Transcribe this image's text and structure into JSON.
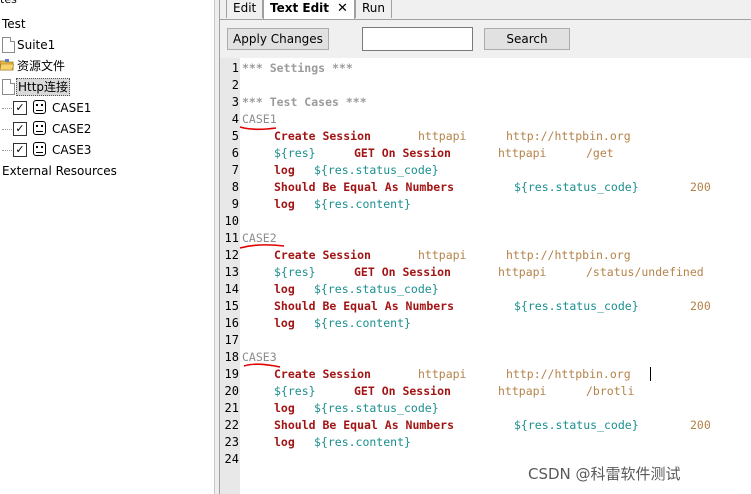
{
  "tree": {
    "header": "tes",
    "root": "Test",
    "suite": "Suite1",
    "resource_folder": "资源文件",
    "http_file": "Http连接",
    "cases": [
      "CASE1",
      "CASE2",
      "CASE3"
    ],
    "external": "External Resources"
  },
  "tabs": [
    "Edit",
    "Text Edit",
    "Run"
  ],
  "active_tab": "Text Edit",
  "toolbar": {
    "apply_label": "Apply Changes",
    "search_value": "",
    "search_label": "Search"
  },
  "editor": {
    "line_numbers": [
      "1",
      "2",
      "3",
      "4",
      "5",
      "6",
      "7",
      "8",
      "9",
      "10",
      "11",
      "12",
      "13",
      "14",
      "15",
      "16",
      "17",
      "18",
      "19",
      "20",
      "21",
      "22",
      "23",
      "24"
    ],
    "settings_header": "*** Settings ***",
    "testcases_header": "*** Test Cases ***",
    "blocks": [
      {
        "name": "CASE1",
        "create_kw": "Create Session",
        "create_alias": "httpapi",
        "create_url": "http://httpbin.org",
        "get_var": "${res}",
        "get_kw": "GET On Session",
        "get_alias": "httpapi",
        "get_path": "/get",
        "log1_kw": "log",
        "log1_arg": "${res.status_code}",
        "assert_kw": "Should Be Equal As Numbers",
        "assert_arg": "${res.status_code}",
        "assert_expected": "200",
        "log2_kw": "log",
        "log2_arg": "${res.content}"
      },
      {
        "name": "CASE2",
        "create_kw": "Create Session",
        "create_alias": "httpapi",
        "create_url": "http://httpbin.org",
        "get_var": "${res}",
        "get_kw": "GET On Session",
        "get_alias": "httpapi",
        "get_path": "/status/undefined",
        "log1_kw": "log",
        "log1_arg": "${res.status_code}",
        "assert_kw": "Should Be Equal As Numbers",
        "assert_arg": "${res.status_code}",
        "assert_expected": "200",
        "log2_kw": "log",
        "log2_arg": "${res.content}"
      },
      {
        "name": "CASE3",
        "create_kw": "Create Session",
        "create_alias": "httpapi",
        "create_url": "http://httpbin.org",
        "get_var": "${res}",
        "get_kw": "GET On Session",
        "get_alias": "httpapi",
        "get_path": "/brotli",
        "log1_kw": "log",
        "log1_arg": "${res.status_code}",
        "assert_kw": "Should Be Equal As Numbers",
        "assert_arg": "${res.status_code}",
        "assert_expected": "200",
        "log2_kw": "log",
        "log2_arg": "${res.content}"
      }
    ]
  },
  "watermark": "CSDN @科雷软件测试",
  "colors": {
    "keyword": "#a31515",
    "argument": "#b5834a",
    "variable": "#1a8f8f",
    "comment_header": "#9b9b9b",
    "annotation_red": "#e00000"
  }
}
